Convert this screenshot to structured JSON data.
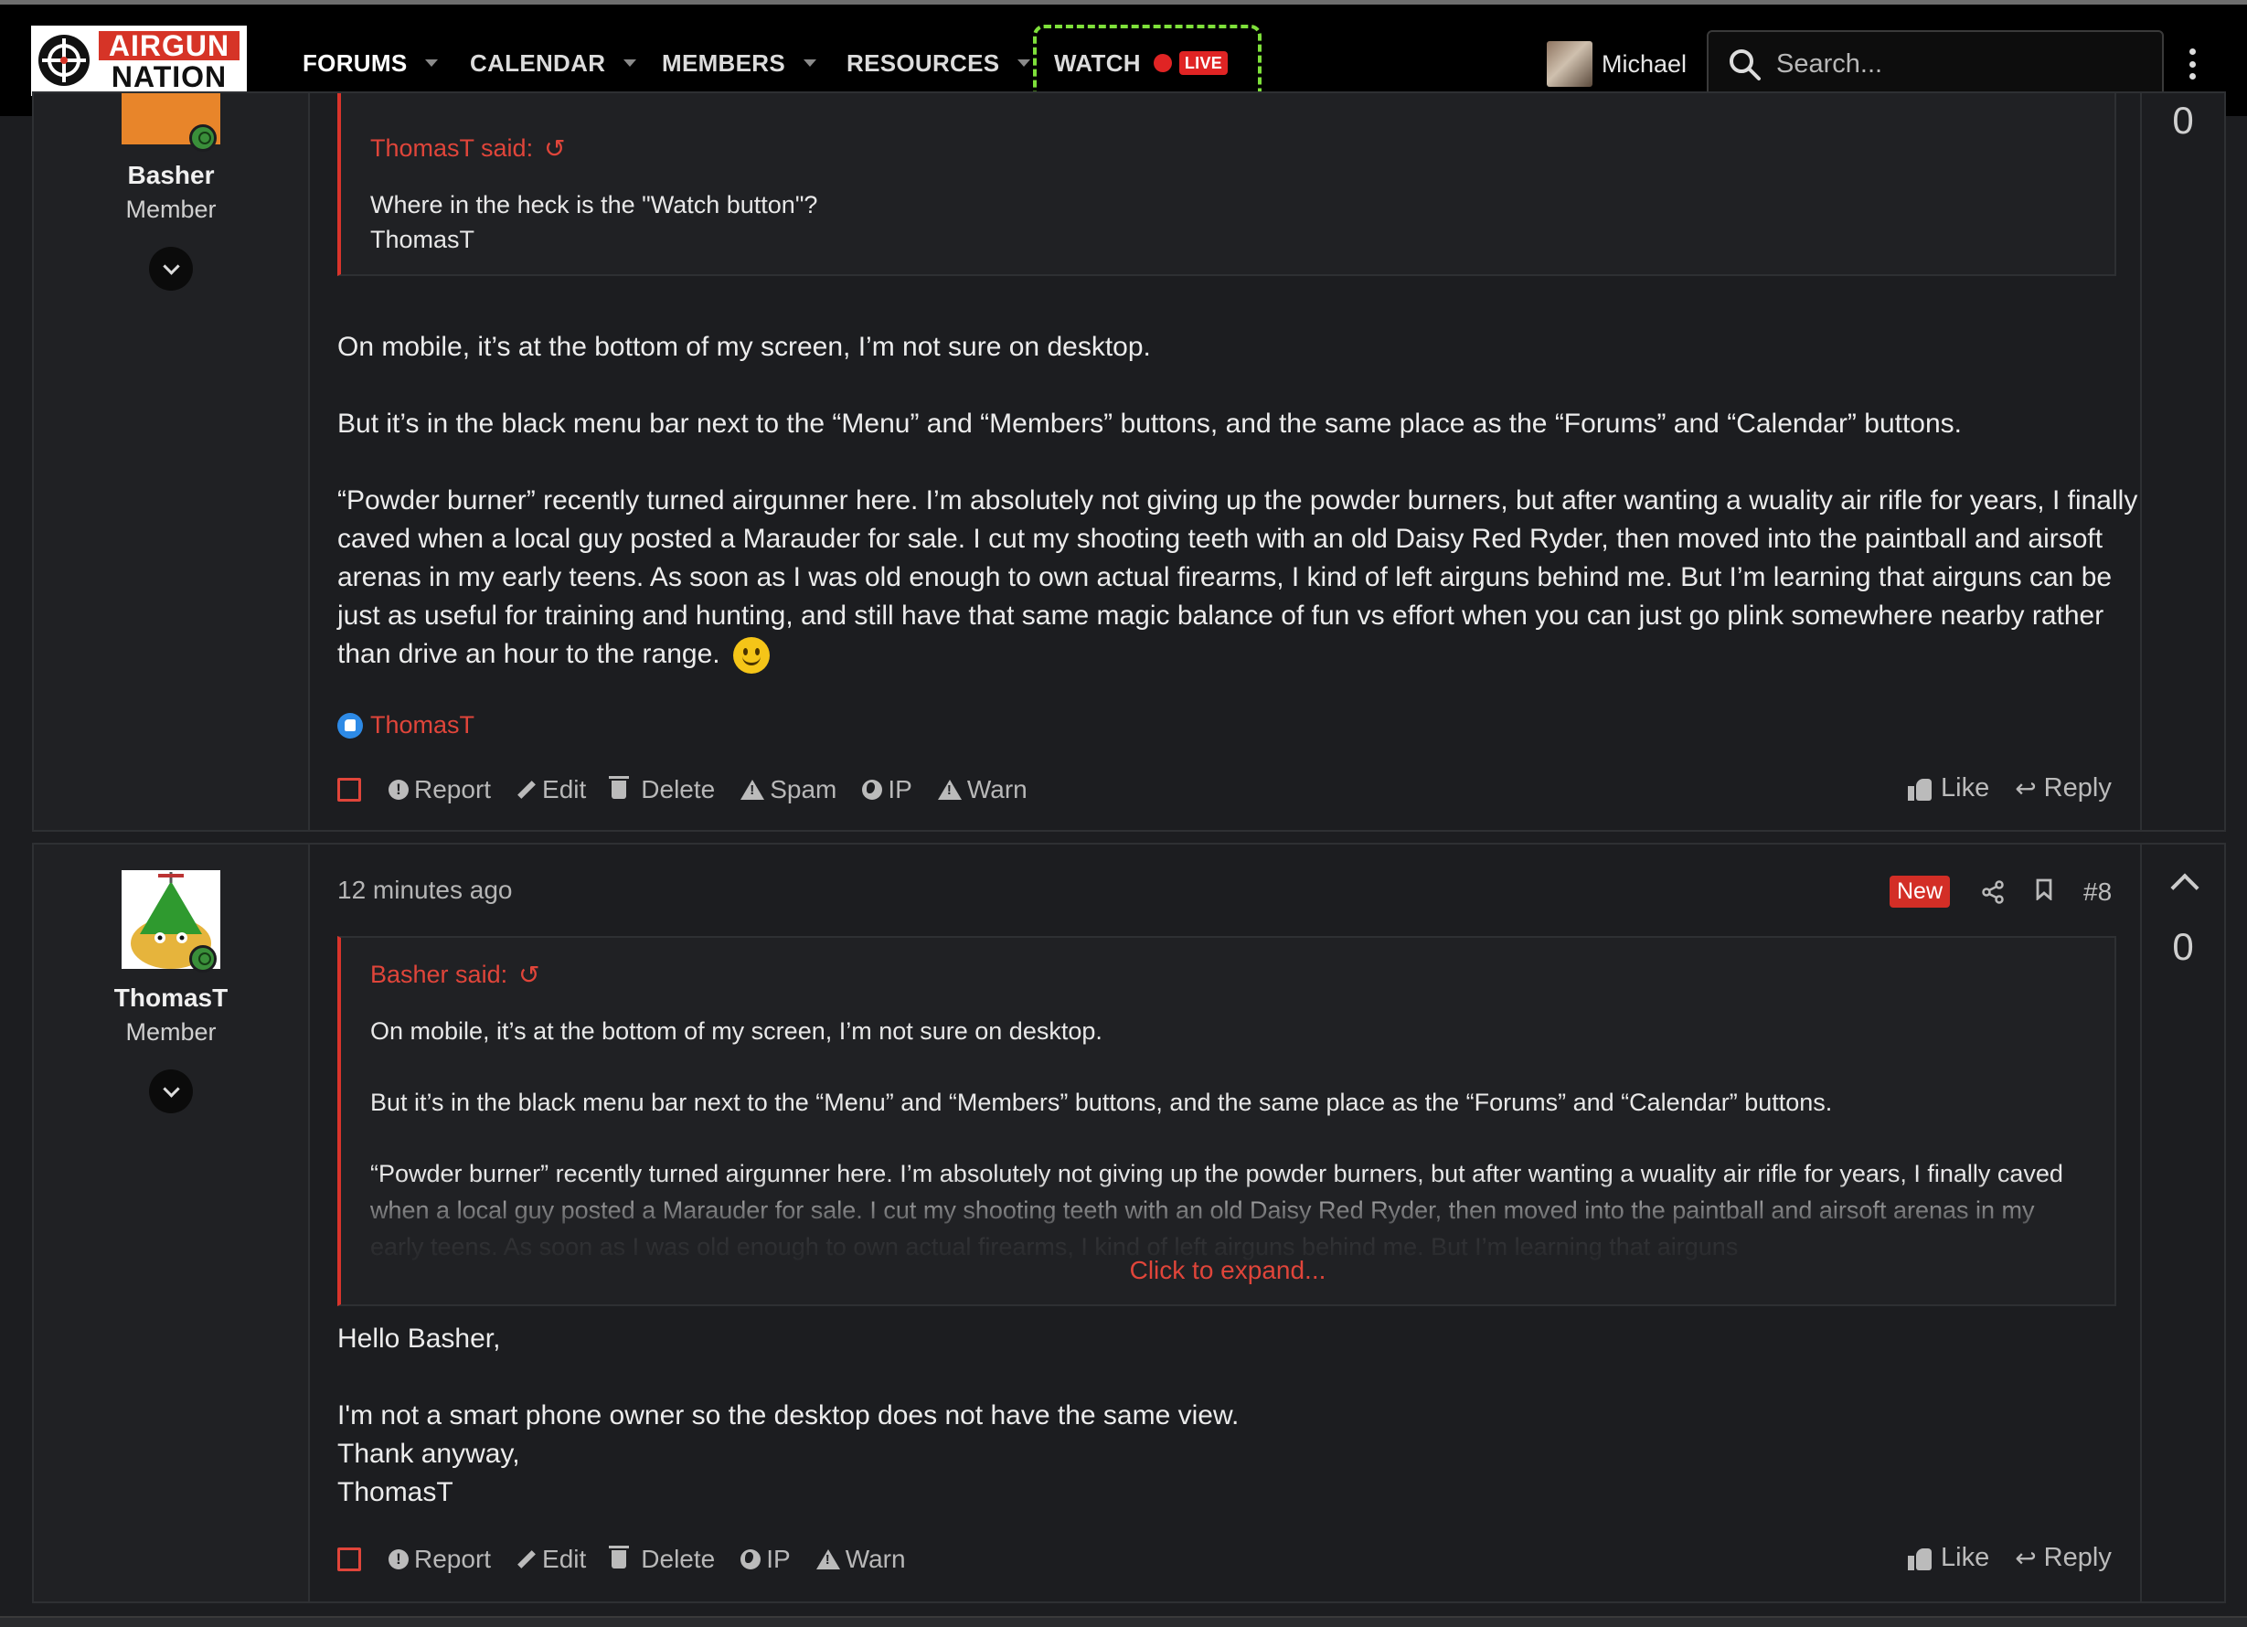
{
  "nav": {
    "logo_line1": "AIRGUN",
    "logo_line2": "NATION",
    "forums": "FORUMS",
    "calendar": "CALENDAR",
    "members": "MEMBERS",
    "resources": "RESOURCES",
    "watch": "WATCH",
    "live": "LIVE",
    "user_name": "Michael",
    "search_placeholder": "Search..."
  },
  "posts": [
    {
      "author": "Basher",
      "role": "Member",
      "vote_count": "0",
      "quote_author": "ThomasT said:",
      "quote_lines": [
        "Where in the heck is the \"Watch button\"?",
        "ThomasT"
      ],
      "paragraphs": [
        "On mobile, it’s at the bottom of my screen, I’m not sure on desktop.",
        "But it’s in the black menu bar next to the “Menu” and “Members” buttons, and the same place as the “Forums” and “Calendar” buttons.",
        "“Powder burner” recently turned airgunner here. I’m absolutely not giving up the powder burners, but after wanting a wuality air rifle for years, I finally caved when a local guy posted a Marauder for sale. I cut my shooting teeth with an old Daisy Red Ryder, then moved into the paintball and airsoft arenas in my early teens. As soon as I was old enough to own actual firearms, I kind of left airguns behind me. But I’m learning that airguns can be just as useful for training and hunting, and still have that same magic balance of fun vs effort when you can just go plink somewhere nearby rather than drive an hour to the range."
      ],
      "reaction_user": "ThomasT",
      "actions": [
        "Report",
        "Edit",
        "Delete",
        "Spam",
        "IP",
        "Warn"
      ],
      "like": "Like",
      "reply": "Reply"
    },
    {
      "author": "ThomasT",
      "role": "Member",
      "time": "12 minutes ago",
      "badge": "New",
      "post_number": "#8",
      "vote_count": "0",
      "quote_author": "Basher said:",
      "quote_lines": [
        "On mobile, it’s at the bottom of my screen, I’m not sure on desktop.",
        "But it’s in the black menu bar next to the “Menu” and “Members” buttons, and the same place as the “Forums” and “Calendar” buttons.",
        "“Powder burner” recently turned airgunner here. I’m absolutely not giving up the powder burners, but after wanting a wuality air rifle for years, I finally caved when a local guy posted a Marauder for sale. I cut my shooting teeth with an old Daisy Red Ryder, then moved into the paintball and airsoft arenas in my early teens. As soon as I was old enough to own actual firearms, I kind of left airguns behind me. But I’m learning that airguns"
      ],
      "expand_label": "Click to expand...",
      "paragraphs": [
        "Hello Basher,",
        "I'm not a smart phone owner so the desktop does not have the same view.",
        "Thank anyway,",
        "ThomasT"
      ],
      "actions": [
        "Report",
        "Edit",
        "Delete",
        "IP",
        "Warn"
      ],
      "like": "Like",
      "reply": "Reply"
    }
  ]
}
